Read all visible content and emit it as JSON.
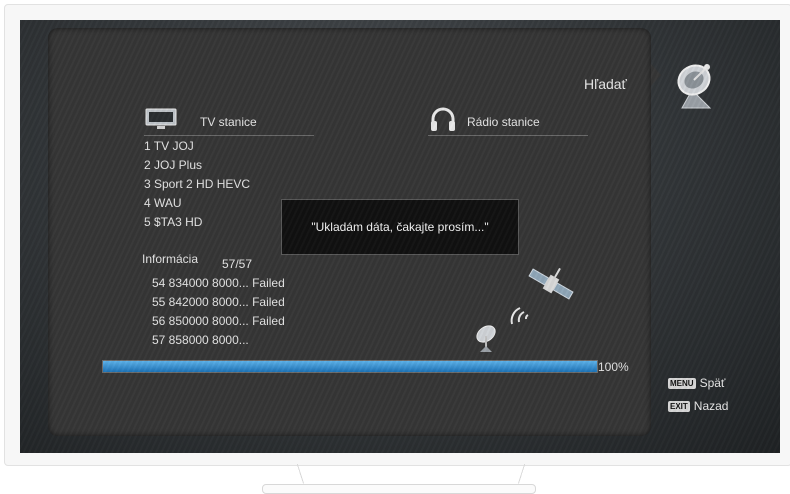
{
  "menu_title": "Hľadať",
  "tv": {
    "header": "TV stanice",
    "items": [
      "1 TV JOJ",
      "2 JOJ Plus",
      "3 Sport 2 HD HEVC",
      "4 WAU",
      "5 $TA3 HD"
    ]
  },
  "radio": {
    "header": "Rádio stanice",
    "items": []
  },
  "info": {
    "label": "Informácia",
    "count": "57/57",
    "log": [
      "54 834000 8000... Failed",
      "55 842000 8000... Failed",
      "56 850000 8000... Failed",
      "57 858000 8000..."
    ]
  },
  "dialog": {
    "message": "\"Ukladám dáta, čakajte prosím...\""
  },
  "progress": {
    "value": 1.0,
    "label": "100%"
  },
  "keys": [
    {
      "key": "MENU",
      "label": "Späť"
    },
    {
      "key": "EXIT",
      "label": "Nazad"
    }
  ],
  "icons": [
    "satellite-dish-icon",
    "tv-icon",
    "headphones-icon",
    "satellite-icon",
    "dish-signal-icon"
  ],
  "colors": {
    "panel": "#363636",
    "progress_fill": "#2e8ad0",
    "text": "#e2e2e2"
  }
}
